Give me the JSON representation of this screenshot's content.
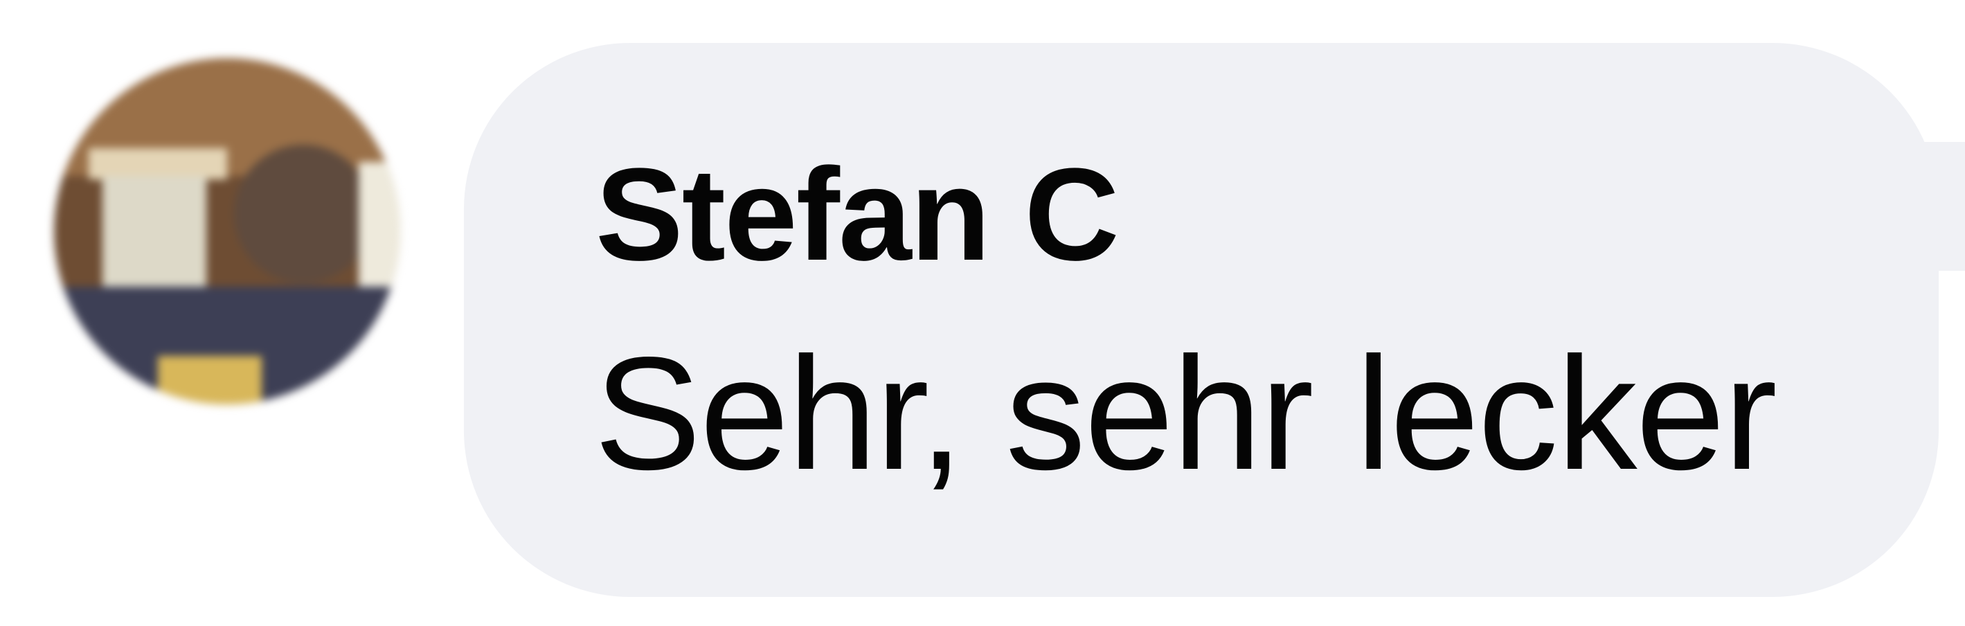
{
  "comment": {
    "author": "Stefan C",
    "text": "Sehr, sehr lecker"
  },
  "avatar": {
    "icon": "profile-photo"
  },
  "colors": {
    "bubble_background": "#f0f1f5",
    "text": "#050505",
    "page_background": "#ffffff"
  }
}
